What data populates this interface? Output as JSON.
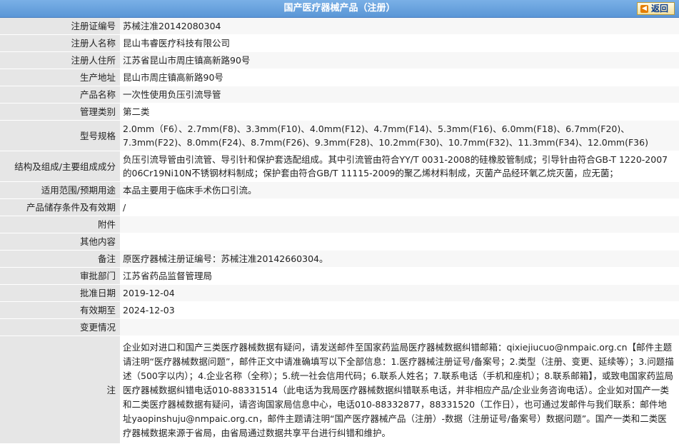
{
  "header": {
    "title": "国产医疗器械产品（注册）",
    "back_label": "返回"
  },
  "rows": [
    {
      "label": "注册证编号",
      "value": "苏械注准20142080304"
    },
    {
      "label": "注册人名称",
      "value": "昆山韦睿医疗科技有限公司"
    },
    {
      "label": "注册人住所",
      "value": "江苏省昆山市周庄镇高新路90号"
    },
    {
      "label": "生产地址",
      "value": "昆山市周庄镇高新路90号"
    },
    {
      "label": "产品名称",
      "value": "一次性使用负压引流导管"
    },
    {
      "label": "管理类别",
      "value": "第二类"
    },
    {
      "label": "型号规格",
      "value": "2.0mm（F6）、2.7mm(F8)、3.3mm(F10)、4.0mm(F12)、4.7mm(F14)、5.3mm(F16)、6.0mm(F18)、6.7mm(F20)、7.3mm(F22)、8.0mm(F24)、8.7mm(F26)、9.3mm(F28)、10.2mm(F30)、10.7mm(F32)、11.3mm(F34)、12.0mm(F36)"
    },
    {
      "label": "结构及组成/主要组成成分",
      "value": "负压引流导管由引流管、导引针和保护套选配组成。其中引流管由符合YY/T 0031-2008的硅橡胶管制成；引导针由符合GB-T 1220-2007的06Cr19Ni10N不锈钢材料制成；保护套由符合GB/T 11115-2009的聚乙烯材料制成，灭菌产品经环氧乙烷灭菌，应无菌；"
    },
    {
      "label": "适用范围/预期用途",
      "value": "本品主要用于临床手术伤口引流。"
    },
    {
      "label": "产品储存条件及有效期",
      "value": "/"
    },
    {
      "label": "附件",
      "value": ""
    },
    {
      "label": "其他内容",
      "value": ""
    },
    {
      "label": "备注",
      "value": "原医疗器械注册证编号：苏械注准20142660304。"
    },
    {
      "label": "审批部门",
      "value": "江苏省药品监督管理局"
    },
    {
      "label": "批准日期",
      "value": "2019-12-04"
    },
    {
      "label": "有效期至",
      "value": "2024-12-03"
    },
    {
      "label": "变更情况",
      "value": ""
    }
  ],
  "note": {
    "label": "注",
    "text": "企业如对进口和国产三类医疗器械数据有疑问，请发送邮件至国家药监局医疗器械数据纠错邮箱：qixiejiucuo@nmpaic.org.cn【邮件主题请注明“医疗器械数据问题”，邮件正文中请准确填写以下全部信息：1.医疗器械注册证号/备案号；2.类型（注册、变更、延续等）；3.问题描述（500字以内）；4.企业名称（全称）；5.统一社会信用代码；6.联系人姓名；7.联系电话（手机和座机）；8.联系邮箱】，或致电国家药监局医疗器械数据纠错电话010-88331514（此电话为我局医疗器械数据纠错联系电话，并非相应产品/企业业务咨询电话）。企业如对国产一类和二类医疗器械数据有疑问，请咨询国家局信息中心，电话010-88332877，88331520（工作日），也可通过发邮件与我们联系：邮件地址yaopinshuju@nmpaic.org.cn，邮件主题请注明“国产医疗器械产品（注册）-数据（注册证号/备案号）数据问题”。国产一类和二类医疗器械数据来源于省局，由省局通过数据共享平台进行纠错和维护。"
  }
}
